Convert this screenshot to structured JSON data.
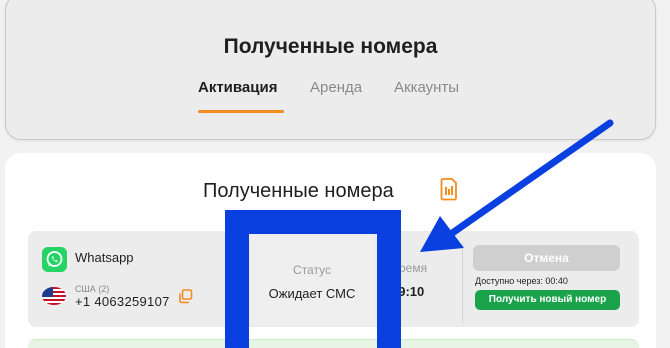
{
  "header": {
    "title": "Полученные номера",
    "tabs": [
      {
        "label": "Активация",
        "active": true
      },
      {
        "label": "Аренда",
        "active": false
      },
      {
        "label": "Аккаунты",
        "active": false
      }
    ]
  },
  "main": {
    "title": "Полученные номера",
    "title_icon": "sim-card-icon",
    "row": {
      "service": "Whatsapp",
      "service_icon": "whatsapp-icon",
      "country": "США (2)",
      "country_flag": "us-flag-icon",
      "phone": "+1 4063259107",
      "status_label": "Статус",
      "status_value": "Ожидает СМС",
      "time_label": "Время",
      "time_value": "19:10",
      "cancel_label": "Отмена",
      "available_text": "Доступно через: 00:40",
      "new_number_label": "Получить новый номер"
    }
  },
  "colors": {
    "accent": "#f28c1e",
    "success": "#1aa34a",
    "annotation": "#0a3fe0"
  }
}
